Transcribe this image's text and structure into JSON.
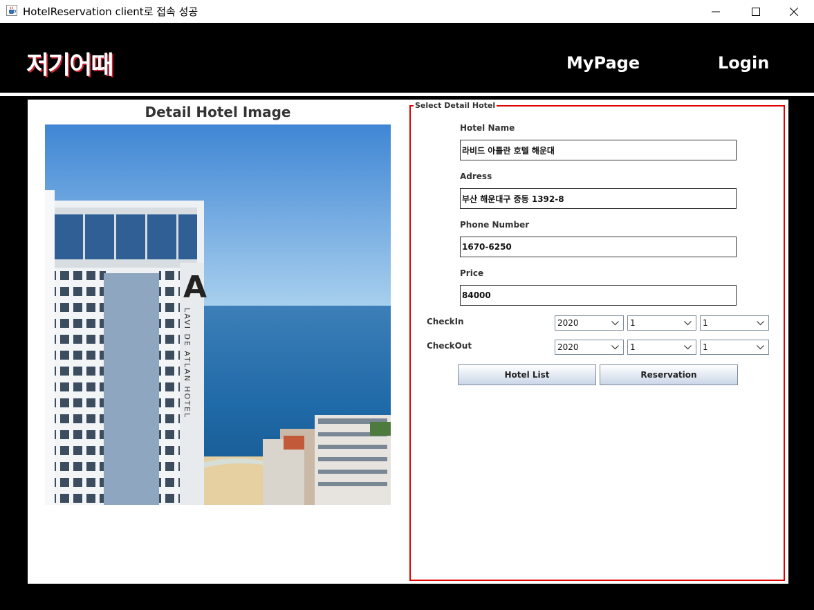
{
  "window": {
    "title": "HotelReservation client로 접속 성공",
    "icon": "java-coffee-icon",
    "controls": [
      "minimize-icon",
      "maximize-icon",
      "close-icon"
    ]
  },
  "header": {
    "logo": "저기어때",
    "nav": {
      "mypage": "MyPage",
      "login": "Login"
    }
  },
  "image_panel": {
    "title": "Detail Hotel Image",
    "sign_letter": "A",
    "sign_text": "LAVI DE ATLAN HOTEL"
  },
  "detail": {
    "legend": "Select Detail Hotel",
    "hotel_name_label": "Hotel Name",
    "hotel_name": "라비드 아틀란 호텔 해운대",
    "address_label": "Adress",
    "address": "부산 해운대구 중동 1392-8",
    "phone_label": "Phone Number",
    "phone": "1670-6250",
    "price_label": "Price",
    "price": "84000",
    "checkin_label": "CheckIn",
    "checkin": {
      "year": "2020",
      "month": "1",
      "day": "1"
    },
    "checkout_label": "CheckOut",
    "checkout": {
      "year": "2020",
      "month": "1",
      "day": "1"
    },
    "hotel_list_button": "Hotel List",
    "reservation_button": "Reservation"
  },
  "colors": {
    "frame": "#000000",
    "fieldset_border": "#dd0000",
    "logo_shadow": "#c8202e"
  }
}
